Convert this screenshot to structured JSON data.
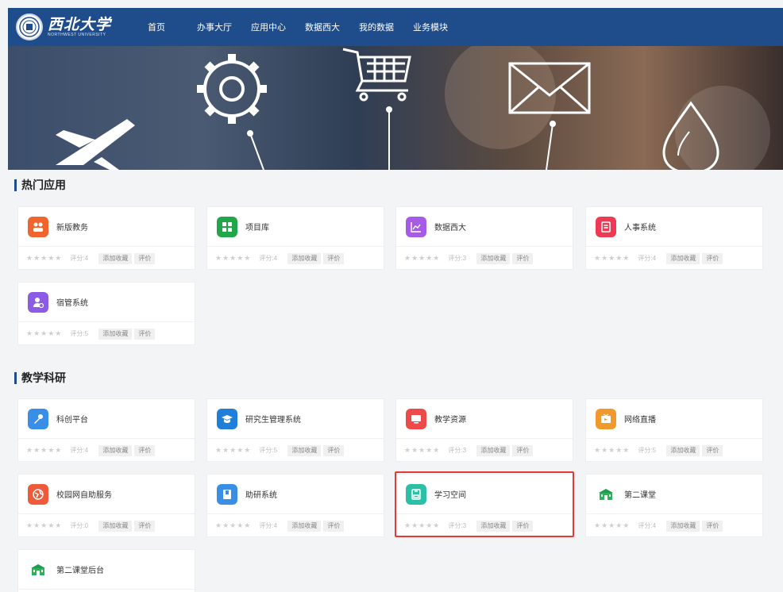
{
  "logo": {
    "cn": "西北大学",
    "en": "NORTHWEST UNIVERSITY"
  },
  "nav": [
    "首页",
    "办事大厅",
    "应用中心",
    "数据西大",
    "我的数据",
    "业务模块"
  ],
  "sections": [
    {
      "title": "热门应用"
    },
    {
      "title": "教学科研"
    }
  ],
  "cards": [
    {
      "name": "新版教务",
      "score": "评分:4",
      "color": "#f0642d",
      "icon": "people-icon"
    },
    {
      "name": "项目库",
      "score": "评分:4",
      "color": "#22a64a",
      "icon": "grid-icon"
    },
    {
      "name": "数据西大",
      "score": "评分:3",
      "color": "#a55be6",
      "icon": "chart-icon"
    },
    {
      "name": "人事系统",
      "score": "评分:4",
      "color": "#ee3a55",
      "icon": "document-icon"
    },
    {
      "name": "宿管系统",
      "score": "评分:5",
      "color": "#8b5be6",
      "icon": "user-icon"
    },
    {
      "name": "科创平台",
      "score": "评分:4",
      "color": "#3a8ee6",
      "icon": "wrench-icon"
    },
    {
      "name": "研究生管理系统",
      "score": "评分:5",
      "color": "#1f7ed8",
      "icon": "graduation-cap-icon"
    },
    {
      "name": "教学资源",
      "score": "评分:3",
      "color": "#ee4a4a",
      "icon": "monitor-icon"
    },
    {
      "name": "网络直播",
      "score": "评分:5",
      "color": "#f0992d",
      "icon": "tv-icon"
    },
    {
      "name": "校园网自助服务",
      "score": "评分:0",
      "color": "#ee5a3a",
      "icon": "globe-icon"
    },
    {
      "name": "助研系统",
      "score": "评分:4",
      "color": "#3a8ee6",
      "icon": "book-icon"
    },
    {
      "name": "学习空间",
      "score": "评分:3",
      "color": "#2bbfa5",
      "icon": "save-icon"
    },
    {
      "name": "第二课堂",
      "score": "评分:4",
      "color": "#ffffff",
      "icon": "building-icon"
    },
    {
      "name": "第二课堂后台",
      "score": "",
      "color": "#ffffff",
      "icon": "building-icon"
    }
  ],
  "labels": {
    "stars": "★★★★★",
    "add_fav": "添加收藏",
    "rate": "评价"
  }
}
